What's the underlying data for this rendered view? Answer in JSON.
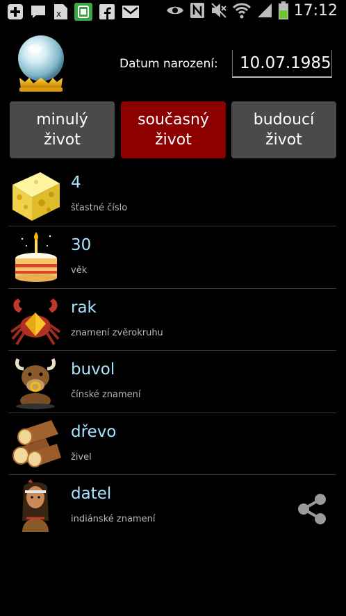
{
  "statusbar": {
    "time": "17:12",
    "left_icons": [
      "plus-icon",
      "chat-icon",
      "sim-icon",
      "android-icon",
      "facebook-icon",
      "gmail-icon"
    ],
    "right_icons": [
      "eye-icon",
      "nfc-icon",
      "mute-icon",
      "wifi-icon",
      "signal-icon",
      "battery-icon"
    ]
  },
  "header": {
    "dob_label": "Datum narození:",
    "dob_value": "10.07.1985"
  },
  "tabs": [
    {
      "line1": "minulý",
      "line2": "život",
      "active": false
    },
    {
      "line1": "současný",
      "line2": "život",
      "active": true
    },
    {
      "line1": "budoucí",
      "line2": "život",
      "active": false
    }
  ],
  "items": [
    {
      "title": "4",
      "subtitle": "šťastné číslo",
      "icon": "cheese-icon"
    },
    {
      "title": "30",
      "subtitle": "věk",
      "icon": "cake-icon"
    },
    {
      "title": "rak",
      "subtitle": "znamení zvěrokruhu",
      "icon": "crab-icon"
    },
    {
      "title": "buvol",
      "subtitle": "čínské znamení",
      "icon": "ox-icon"
    },
    {
      "title": "dřevo",
      "subtitle": "živel",
      "icon": "logs-icon"
    },
    {
      "title": "datel",
      "subtitle": "indiánské znamení",
      "icon": "native-woman-icon"
    }
  ],
  "colors": {
    "accent_text": "#a8e4ff",
    "active_tab": "#8c0000",
    "inactive_tab": "#4a4a4a"
  }
}
